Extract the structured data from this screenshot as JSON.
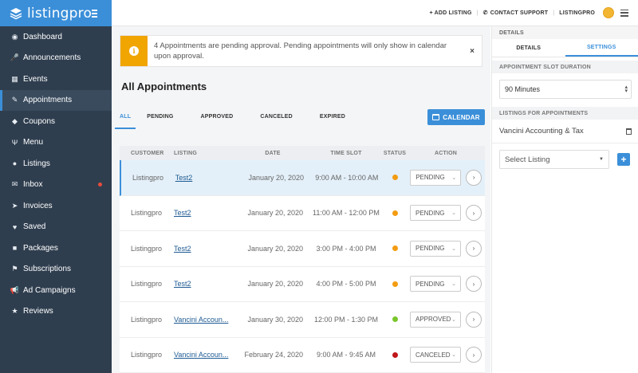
{
  "brand": {
    "name": "listingpro"
  },
  "sidebar": {
    "items": [
      {
        "label": "Dashboard",
        "icon": "dashboard-icon",
        "glyph": "◉"
      },
      {
        "label": "Announcements",
        "icon": "microphone-icon",
        "glyph": "🎤"
      },
      {
        "label": "Events",
        "icon": "calendar-icon",
        "glyph": "▦"
      },
      {
        "label": "Appointments",
        "icon": "edit-icon",
        "glyph": "✎",
        "active": true
      },
      {
        "label": "Coupons",
        "icon": "tag-icon",
        "glyph": "◆"
      },
      {
        "label": "Menu",
        "icon": "utensils-icon",
        "glyph": "Ψ"
      },
      {
        "label": "Listings",
        "icon": "map-marker-icon",
        "glyph": "●"
      },
      {
        "label": "Inbox",
        "icon": "envelope-icon",
        "glyph": "✉",
        "badge": true
      },
      {
        "label": "Invoices",
        "icon": "send-icon",
        "glyph": "➤"
      },
      {
        "label": "Saved",
        "icon": "heart-icon",
        "glyph": "♥"
      },
      {
        "label": "Packages",
        "icon": "package-icon",
        "glyph": "■"
      },
      {
        "label": "Subscriptions",
        "icon": "flag-icon",
        "glyph": "⚑"
      },
      {
        "label": "Ad Campaigns",
        "icon": "bullhorn-icon",
        "glyph": "📢"
      },
      {
        "label": "Reviews",
        "icon": "star-icon",
        "glyph": "★"
      }
    ]
  },
  "header": {
    "add_listing": "+ ADD LISTING",
    "contact_support": "CONTACT SUPPORT",
    "user": "LISTINGPRO"
  },
  "alert": {
    "message": "4 Appointments are pending approval. Pending appointments will only show in calendar upon approval.",
    "close": "×"
  },
  "page": {
    "title": "All Appointments"
  },
  "tabs": [
    "ALL",
    "PENDING",
    "APPROVED",
    "CANCELED",
    "EXPIRED"
  ],
  "calendar_button": "CALENDAR",
  "table": {
    "headers": [
      "CUSTOMER",
      "LISTING",
      "DATE",
      "TIME SLOT",
      "STATUS",
      "ACTION"
    ],
    "rows": [
      {
        "customer": "Listingpro",
        "listing": "Test2",
        "date": "January 20, 2020",
        "time": "9:00 AM - 10:00 AM",
        "status_color": "#f39c12",
        "action": "PENDING"
      },
      {
        "customer": "Listingpro",
        "listing": "Test2",
        "date": "January 20, 2020",
        "time": "11:00 AM - 12:00 PM",
        "status_color": "#f39c12",
        "action": "PENDING"
      },
      {
        "customer": "Listingpro",
        "listing": "Test2",
        "date": "January 20, 2020",
        "time": "3:00 PM - 4:00 PM",
        "status_color": "#f39c12",
        "action": "PENDING"
      },
      {
        "customer": "Listingpro",
        "listing": "Test2",
        "date": "January 20, 2020",
        "time": "4:00 PM - 5:00 PM",
        "status_color": "#f39c12",
        "action": "PENDING"
      },
      {
        "customer": "Listingpro",
        "listing": "Vancini Accoun...",
        "date": "January 30, 2020",
        "time": "12:00 PM - 1:30 PM",
        "status_color": "#7ac52b",
        "action": "APPROVED"
      },
      {
        "customer": "Listingpro",
        "listing": "Vancini Accoun...",
        "date": "February 24, 2020",
        "time": "9:00 AM - 9:45 AM",
        "status_color": "#c0161b",
        "action": "CANCELED"
      }
    ]
  },
  "panel": {
    "heading": "DETAILS",
    "tabs": [
      "DETAILS",
      "SETTINGS"
    ],
    "slot_label": "APPOINTMENT SLOT DURATION",
    "slot_value": "90 Minutes",
    "listings_label": "LISTINGS FOR APPOINTMENTS",
    "listing_item": "Vancini Accounting & Tax",
    "select_placeholder": "Select Listing",
    "add": "+"
  },
  "colors": {
    "accent": "#3b8fd9",
    "sidebar": "#2f3e4f",
    "pending": "#f39c12",
    "approved": "#7ac52b",
    "canceled": "#c0161b"
  }
}
